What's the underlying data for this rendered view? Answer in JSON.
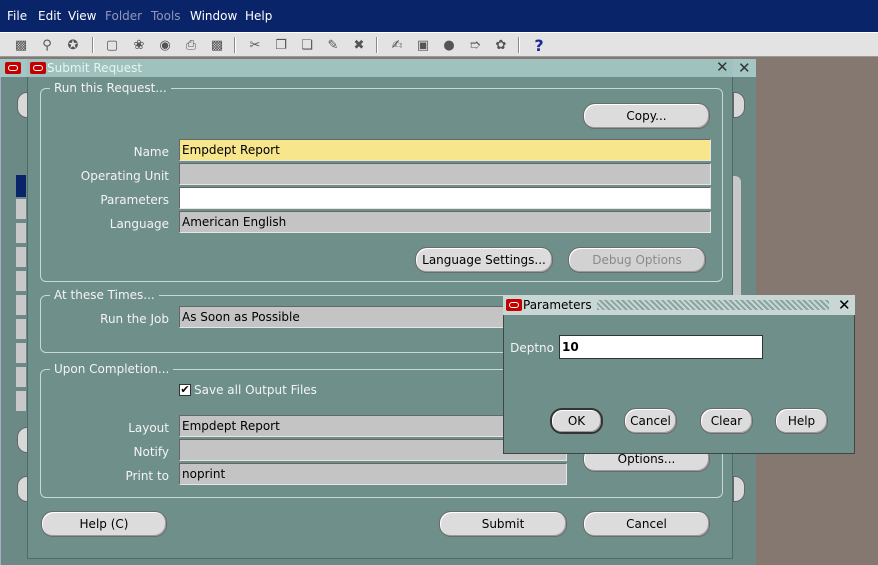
{
  "menu": {
    "items": [
      {
        "label": "File",
        "disabled": false
      },
      {
        "label": "Edit",
        "disabled": false
      },
      {
        "label": "View",
        "disabled": false
      },
      {
        "label": "Folder",
        "disabled": true
      },
      {
        "label": "Tools",
        "disabled": true
      },
      {
        "label": "Window",
        "disabled": false
      },
      {
        "label": "Help",
        "disabled": false
      }
    ]
  },
  "toolbar": {
    "icons": [
      "new-record-icon",
      "find-icon",
      "navigator-icon",
      "save-icon",
      "next-step-icon",
      "switch-responsibility-icon",
      "print-icon",
      "close-form-icon",
      "cut-icon",
      "copy-icon",
      "paste-icon",
      "clear-record-icon",
      "delete-record-icon",
      "edit-field-icon",
      "zoom-icon",
      "translations-icon",
      "attachments-icon",
      "folder-tools-icon",
      "help-icon"
    ]
  },
  "submit_window": {
    "title": "Submit Request",
    "run_group": {
      "label": "Run this Request...",
      "copy_button": "Copy...",
      "name_label": "Name",
      "name_value": "Empdept Report",
      "operating_unit_label": "Operating Unit",
      "operating_unit_value": "",
      "parameters_label": "Parameters",
      "parameters_value": "",
      "language_label": "Language",
      "language_value": "American English",
      "language_settings_button": "Language Settings...",
      "debug_options_button": "Debug Options"
    },
    "times_group": {
      "label": "At these Times...",
      "run_job_label": "Run the Job",
      "run_job_value": "As Soon as Possible"
    },
    "completion_group": {
      "label": "Upon Completion...",
      "save_output_label": "Save all Output Files",
      "save_output_checked": true,
      "layout_label": "Layout",
      "layout_value": "Empdept Report",
      "notify_label": "Notify",
      "notify_value": "",
      "print_to_label": "Print to",
      "print_to_value": "noprint",
      "options_button": "Options..."
    },
    "help_button": "Help (C)",
    "submit_button": "Submit",
    "cancel_button": "Cancel"
  },
  "parameters_dialog": {
    "title": "Parameters",
    "deptno_label": "Deptno",
    "deptno_value": "10",
    "ok_button": "OK",
    "cancel_button": "Cancel",
    "clear_button": "Clear",
    "help_button": "Help"
  }
}
